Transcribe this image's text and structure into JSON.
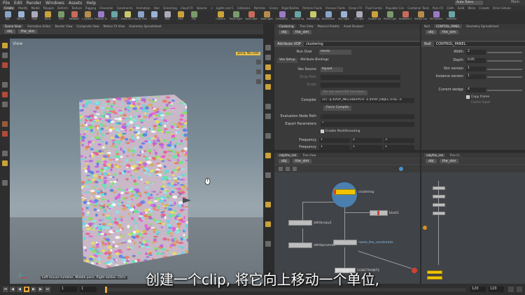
{
  "menubar": {
    "items": [
      "File",
      "Edit",
      "Render",
      "Windows",
      "Assets",
      "Help"
    ],
    "build": "Auto Takes",
    "desktop": "Main"
  },
  "shelf": {
    "tabs": [
      "Create",
      "Modify",
      "Model",
      "Polygon",
      "Deform",
      "Texture",
      "Rigging",
      "Character",
      "Constraints",
      "Animation",
      "Hair",
      "Grooming",
      "Cloud FX",
      "Volume",
      "+",
      "Lights and C",
      "Collisions",
      "Particles",
      "Grains",
      "Rigid Bodies",
      "Particle Fluids",
      "Viscous Fluids",
      "Ocean FX",
      "Fluid Contai",
      "Populate Con",
      "Container Tools",
      "Pyro FX",
      "Cloth",
      "Solid",
      "Wires",
      "Crowds",
      "Drive Simula"
    ],
    "tools_left": [
      "Box",
      "Sphere",
      "Tube",
      "Torus",
      "Grid",
      "Metaball",
      "L-System",
      "Platonic Sol",
      "Curve",
      "Draw Curve",
      "Spray Paint",
      "Circle",
      "Text",
      "Font",
      "File"
    ],
    "tools_right": [
      "Camera",
      "Point Light",
      "Spot Light",
      "Area Light",
      "Geometry Lt",
      "Volume Light",
      "Distant Light",
      "Environment",
      "Sky Light",
      "GI Light",
      "Caustic Light",
      "Portal Light",
      "Ambient Lig",
      "Stereo Cam",
      "VR Camera",
      "Switcher"
    ]
  },
  "viewport_pane": {
    "tabs": [
      "Scene View",
      "Animation Editor",
      "Render View",
      "Composite View",
      "Motion FX View",
      "Geometry Spreadsheet"
    ],
    "path_obj": "obj",
    "path_node": "the_sim",
    "title": "View",
    "camera_menu": "persp",
    "cam_menu": "No cam",
    "status": "Left mouse tumbles. Middle pans. Right dollies. Ctrl+"
  },
  "params_pane": {
    "tabs": [
      "Clustering",
      "Tree View",
      "Material Palette",
      "Asset Browser"
    ],
    "path_obj": "obj",
    "path_node": "the_sim",
    "node_type": "Attribute VOP",
    "node_name": "clustering",
    "run_over_label": "Run Over",
    "run_over_value": "Points",
    "subtabs": [
      "Vex Setup",
      "Attribute Bindings"
    ],
    "vex_source_label": "Vex Source",
    "vex_source_value": "Myself",
    "shop_path_label": "Shop Path",
    "script_label": "Script",
    "no_load_label": "Do not load VEX functions",
    "compiler_label": "Compiler",
    "compiler_value": "vcc -q $VOP_INCLUDEPATH -o $VOP_OBJECTFILE -e",
    "force_compile": "Force Compile",
    "eval_path_label": "Evaluation Node Path",
    "eval_path_value": ".",
    "export_params_label": "Export Parameters",
    "export_params_value": "*",
    "multithread_label": "Enable Multithreading",
    "freq_label_1": "Frequency",
    "freq_values_1": [
      "1",
      "2",
      "3"
    ],
    "freq_label_2": "Frequency",
    "freq_values_2": [
      "1",
      "1",
      "1"
    ]
  },
  "right_pane": {
    "tabs": [
      "Null",
      "CONTROL_PANEL",
      "Geometry Spreadsheet"
    ],
    "path_obj": "obj",
    "path_node": "the_sim",
    "node_type": "Null",
    "node_name": "CONTROL_PANEL",
    "rows": [
      {
        "label": "Width",
        "value": "2"
      },
      {
        "label": "Depth",
        "value": "0.05"
      },
      {
        "label": "Sim version",
        "value": "1"
      },
      {
        "label": "Instance version",
        "value": "1"
      },
      {
        "label": "Current wedge",
        "value": "4"
      }
    ],
    "copy_frame": "Copy frame",
    "cache_input": "Cache Input"
  },
  "network_pane": {
    "tabs": [
      "/obj/the_sim",
      "Tree View"
    ],
    "path_obj": "obj",
    "path_node": "the_sim",
    "nodes": {
      "clustering": "clustering",
      "attribcopy1": "attribcopy1",
      "blast1": "blast1",
      "attribpromote": "attribpromote",
      "name_constraints": "name_the_constraints",
      "constraints": "CONSTRAINTS"
    }
  },
  "mini_network_pane": {
    "tabs": [
      "/obj/the_sim",
      "Tree Vi..."
    ],
    "path_obj": "obj",
    "path_node": "the_sim"
  },
  "timeline": {
    "start": "1",
    "frame": "1",
    "end": "120",
    "end2": "120"
  },
  "subtitle": "创建一个clip, 将它向上移动一个单位,",
  "colors": {
    "selected_node": "#f2c400",
    "accent": "#e8c34a"
  }
}
